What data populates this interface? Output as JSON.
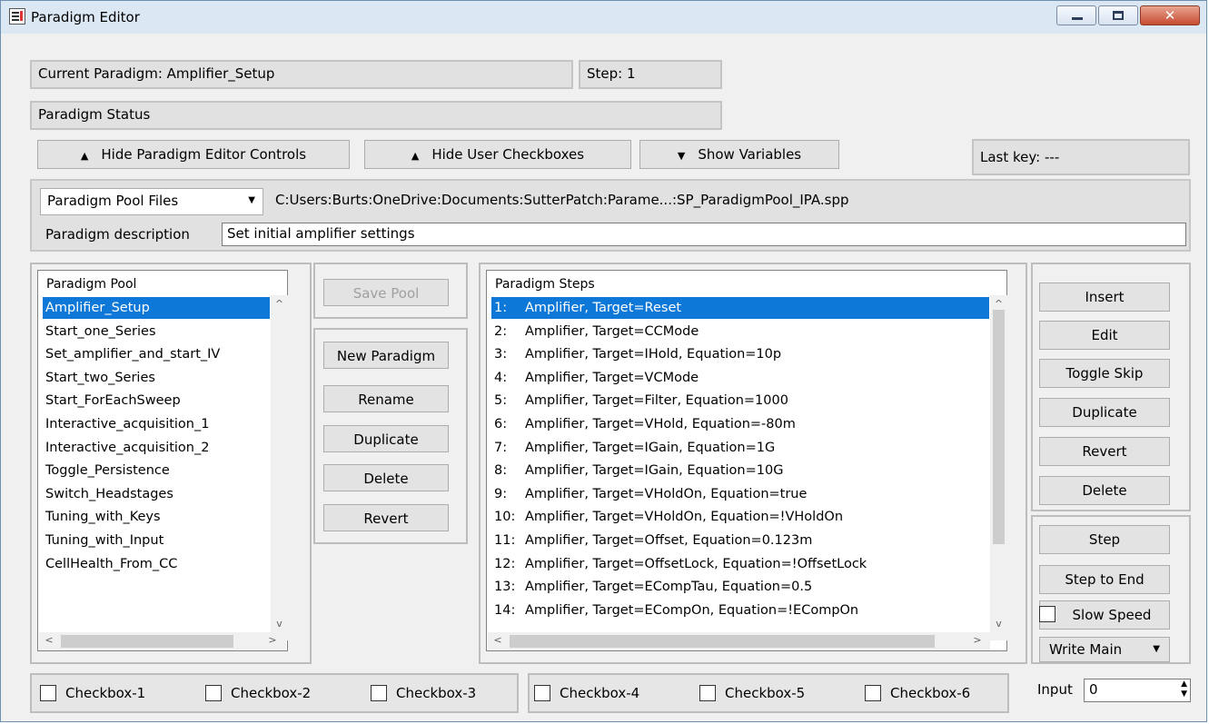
{
  "window": {
    "title": "Paradigm Editor",
    "close_glyph": "✕"
  },
  "status": {
    "current_paradigm": "Current Paradigm:  Amplifier_Setup",
    "step": "Step: 1",
    "paradigm_status": "Paradigm Status",
    "last_key": "Last key: ---"
  },
  "toolbar": {
    "hide_editor_controls": "Hide Paradigm Editor Controls",
    "hide_user_checkboxes": "Hide User Checkboxes",
    "show_variables": "Show Variables",
    "up_glyph": "▲",
    "down_glyph": "▼"
  },
  "file": {
    "pool_files_select": "Paradigm Pool Files",
    "path": "C:Users:Burts:OneDrive:Documents:SutterPatch:Parame...:SP_ParadigmPool_IPA.spp",
    "description_label": "Paradigm description",
    "description_value": "Set initial amplifier settings"
  },
  "pool": {
    "header": "Paradigm Pool",
    "selected_index": 0,
    "items": [
      "Amplifier_Setup",
      "Start_one_Series",
      "Set_amplifier_and_start_IV",
      "Start_two_Series",
      "Start_ForEachSweep",
      "Interactive_acquisition_1",
      "Interactive_acquisition_2",
      "Toggle_Persistence",
      "Switch_Headstages",
      "Tuning_with_Keys",
      "Tuning_with_Input",
      "CellHealth_From_CC"
    ]
  },
  "pool_buttons": {
    "save_pool": "Save Pool",
    "new_paradigm": "New Paradigm",
    "rename": "Rename",
    "duplicate": "Duplicate",
    "delete": "Delete",
    "revert": "Revert"
  },
  "steps": {
    "header": "Paradigm Steps",
    "selected_index": 0,
    "items": [
      {
        "num": "1:",
        "text": "Amplifier, Target=Reset"
      },
      {
        "num": "2:",
        "text": "Amplifier, Target=CCMode"
      },
      {
        "num": "3:",
        "text": "Amplifier, Target=IHold, Equation=10p"
      },
      {
        "num": "4:",
        "text": "Amplifier, Target=VCMode"
      },
      {
        "num": "5:",
        "text": "Amplifier, Target=Filter, Equation=1000"
      },
      {
        "num": "6:",
        "text": "Amplifier, Target=VHold, Equation=-80m"
      },
      {
        "num": "7:",
        "text": "Amplifier, Target=IGain, Equation=1G"
      },
      {
        "num": "8:",
        "text": "Amplifier, Target=IGain, Equation=10G"
      },
      {
        "num": "9:",
        "text": "Amplifier, Target=VHoldOn, Equation=true"
      },
      {
        "num": "10:",
        "text": "Amplifier, Target=VHoldOn, Equation=!VHoldOn"
      },
      {
        "num": "11:",
        "text": "Amplifier, Target=Offset, Equation=0.123m"
      },
      {
        "num": "12:",
        "text": "Amplifier, Target=OffsetLock, Equation=!OffsetLock"
      },
      {
        "num": "13:",
        "text": "Amplifier, Target=ECompTau, Equation=0.5"
      },
      {
        "num": "14:",
        "text": "Amplifier, Target=ECompOn, Equation=!ECompOn"
      }
    ]
  },
  "step_buttons": {
    "insert": "Insert",
    "edit": "Edit",
    "toggle_skip": "Toggle Skip",
    "duplicate": "Duplicate",
    "revert": "Revert",
    "delete": "Delete"
  },
  "run_controls": {
    "step": "Step",
    "step_to_end": "Step to End",
    "slow_speed": "Slow Speed",
    "write_main": "Write Main"
  },
  "checkboxes": [
    "Checkbox-1",
    "Checkbox-2",
    "Checkbox-3",
    "Checkbox-4",
    "Checkbox-5",
    "Checkbox-6"
  ],
  "input": {
    "label": "Input",
    "value": "0"
  },
  "icons": [
    "app-icon",
    "minimize-icon",
    "maximize-icon",
    "close-icon",
    "triangle-up-icon",
    "triangle-down-icon",
    "dropdown-arrow-icon",
    "scroll-up-icon",
    "scroll-down-icon",
    "scroll-left-icon",
    "scroll-right-icon",
    "spinner-icon"
  ]
}
